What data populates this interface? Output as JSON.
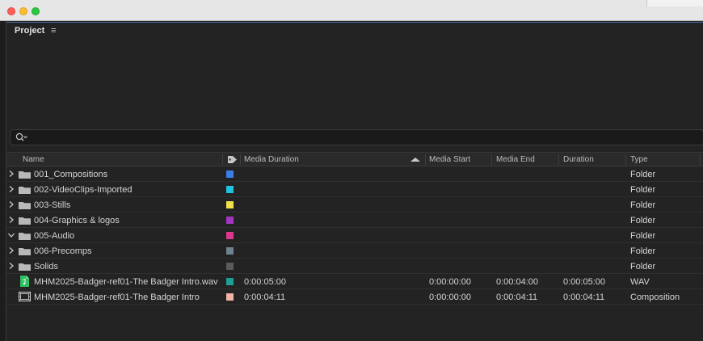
{
  "panel": {
    "title": "Project",
    "menu_glyph": "≡"
  },
  "search": {
    "placeholder": ""
  },
  "columns": {
    "name": "Name",
    "media_duration": "Media Duration",
    "media_start": "Media Start",
    "media_end": "Media End",
    "duration": "Duration",
    "type": "Type"
  },
  "rows": [
    {
      "name": "001_Compositions",
      "kind": "folder",
      "expanded": false,
      "label_color": "#3d7ee6",
      "media_duration": "",
      "media_start": "",
      "media_end": "",
      "duration": "",
      "type": "Folder"
    },
    {
      "name": "002-VideoClips-Imported",
      "kind": "folder",
      "expanded": false,
      "label_color": "#1fc3e0",
      "media_duration": "",
      "media_start": "",
      "media_end": "",
      "duration": "",
      "type": "Folder"
    },
    {
      "name": "003-Stills",
      "kind": "folder",
      "expanded": false,
      "label_color": "#f2e14b",
      "media_duration": "",
      "media_start": "",
      "media_end": "",
      "duration": "",
      "type": "Folder"
    },
    {
      "name": "004-Graphics & logos",
      "kind": "folder",
      "expanded": false,
      "label_color": "#a335c0",
      "media_duration": "",
      "media_start": "",
      "media_end": "",
      "duration": "",
      "type": "Folder"
    },
    {
      "name": "005-Audio",
      "kind": "folder",
      "expanded": true,
      "label_color": "#e0368e",
      "media_duration": "",
      "media_start": "",
      "media_end": "",
      "duration": "",
      "type": "Folder"
    },
    {
      "name": "006-Precomps",
      "kind": "folder",
      "expanded": false,
      "label_color": "#6f8290",
      "media_duration": "",
      "media_start": "",
      "media_end": "",
      "duration": "",
      "type": "Folder"
    },
    {
      "name": "Solids",
      "kind": "folder",
      "expanded": false,
      "label_color": "#5a5a5a",
      "media_duration": "",
      "media_start": "",
      "media_end": "",
      "duration": "",
      "type": "Folder"
    },
    {
      "name": "MHM2025-Badger-ref01-The Badger Intro.wav",
      "kind": "audio",
      "expanded": false,
      "label_color": "#1f9e96",
      "media_duration": "0:00:05:00",
      "media_start": "0:00:00:00",
      "media_end": "0:00:04:00",
      "duration": "0:00:05:00",
      "type": "WAV"
    },
    {
      "name": "MHM2025-Badger-ref01-The Badger Intro",
      "kind": "composition",
      "expanded": false,
      "label_color": "#f0b3a8",
      "media_duration": "0:00:04:11",
      "media_start": "0:00:00:00",
      "media_end": "0:00:04:11",
      "duration": "0:00:04:11",
      "type": "Composition"
    }
  ]
}
